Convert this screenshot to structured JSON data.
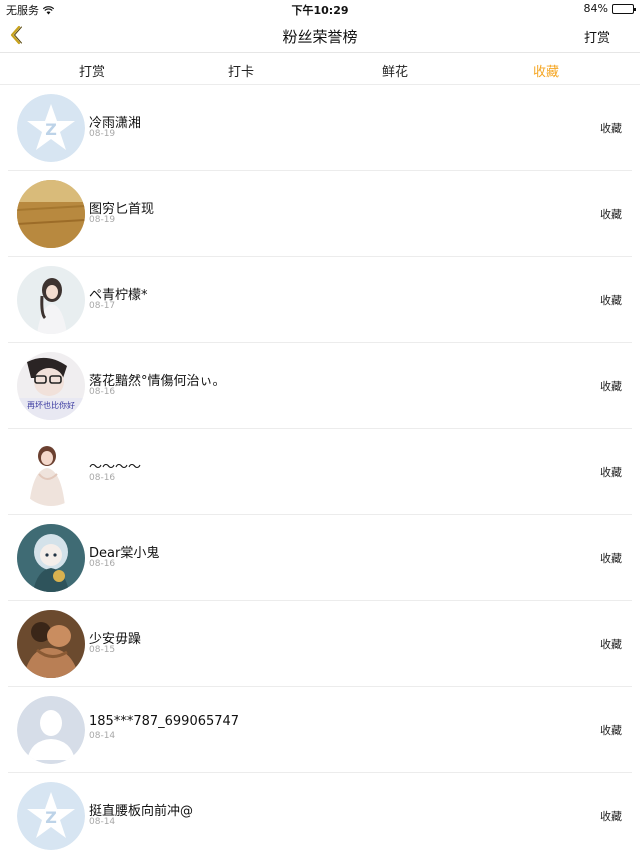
{
  "status_bar": {
    "carrier": "无服务",
    "time": "下午10:29",
    "battery": "84%",
    "battery_level": 0.84
  },
  "nav": {
    "title": "粉丝荣誉榜",
    "action": "打赏",
    "back_icon": "chevron-left-icon"
  },
  "tabs": [
    {
      "label": "打赏",
      "active": false
    },
    {
      "label": "打卡",
      "active": false
    },
    {
      "label": "鲜花",
      "active": false
    },
    {
      "label": "收藏",
      "active": true
    }
  ],
  "colors": {
    "accent": "#f5a623",
    "divider": "#ececec",
    "date_text": "#a8a8a8"
  },
  "fans": [
    {
      "name": "冷雨潇湘",
      "date": "08-19",
      "action": "收藏",
      "avatar": "default-q-avatar"
    },
    {
      "name": "图穷匕首现",
      "date": "08-19",
      "action": "收藏",
      "avatar": "wheat-field-avatar"
    },
    {
      "name": "ペ青柠檬*",
      "date": "08-17",
      "action": "收藏",
      "avatar": "girl-photo-avatar"
    },
    {
      "name": "落花黯然°情傷何治ぃ。",
      "date": "08-16",
      "action": "收藏",
      "avatar": "boy-glasses-avatar"
    },
    {
      "name": "～～～～",
      "date": "08-16",
      "action": "收藏",
      "avatar": "woman-photo-avatar"
    },
    {
      "name": "Dear棠小鬼",
      "date": "08-16",
      "action": "收藏",
      "avatar": "anime-girl-avatar"
    },
    {
      "name": "少安毋躁",
      "date": "08-15",
      "action": "收藏",
      "avatar": "couple-photo-avatar"
    },
    {
      "name": "185***787_699065747",
      "date": "08-14",
      "action": "收藏",
      "avatar": "default-person-avatar"
    },
    {
      "name": "挺直腰板向前冲@",
      "date": "08-14",
      "action": "收藏",
      "avatar": "default-q-avatar"
    }
  ]
}
